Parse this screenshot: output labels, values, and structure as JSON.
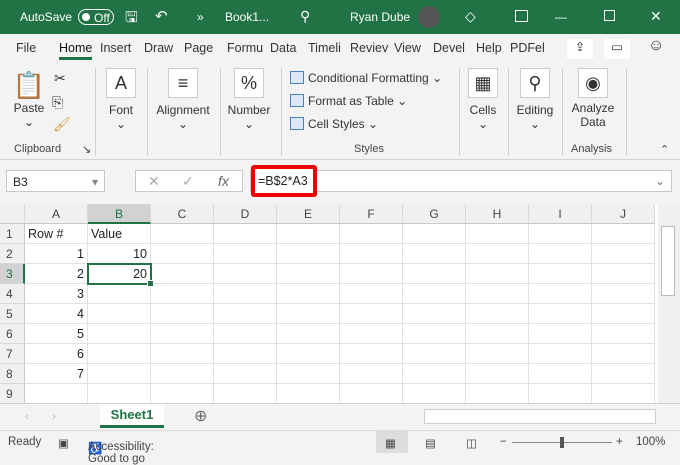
{
  "titlebar": {
    "autosave": "AutoSave",
    "toggle": "Off",
    "more": "»",
    "filename": "Book1...",
    "user": "Ryan Dube"
  },
  "tabs": [
    "File",
    "Home",
    "Insert",
    "Draw",
    "Page",
    "Formu",
    "Data",
    "Timeli",
    "Reviev",
    "View",
    "Devel",
    "Help",
    "PDFel"
  ],
  "ribbon": {
    "paste": "Paste",
    "clipboard": "Clipboard",
    "font": "Font",
    "alignment": "Alignment",
    "number": "Number",
    "conditional": "Conditional Formatting",
    "format_table": "Format as Table",
    "cell_styles": "Cell Styles",
    "styles": "Styles",
    "cells": "Cells",
    "editing": "Editing",
    "analyze": "Analyze",
    "analyze2": "Data",
    "analysis": "Analysis"
  },
  "formula_bar": {
    "name_box": "B3",
    "formula": "=B$2*A3"
  },
  "columns": [
    "A",
    "B",
    "C",
    "D",
    "E",
    "F",
    "G",
    "H",
    "I",
    "J"
  ],
  "rows": [
    "1",
    "2",
    "3",
    "4",
    "5",
    "6",
    "7",
    "8",
    "9"
  ],
  "cells": {
    "A1": "Row #",
    "B1": "Value",
    "A2": "1",
    "B2": "10",
    "A3": "2",
    "B3": "20",
    "A4": "3",
    "A5": "4",
    "A6": "5",
    "A7": "6",
    "A8": "7"
  },
  "sheet_tab": "Sheet1",
  "status": {
    "ready": "Ready",
    "accessibility": "Accessibility: Good to go",
    "zoom": "100%"
  },
  "colors": {
    "accent": "#217346",
    "highlight": "#e00000"
  }
}
